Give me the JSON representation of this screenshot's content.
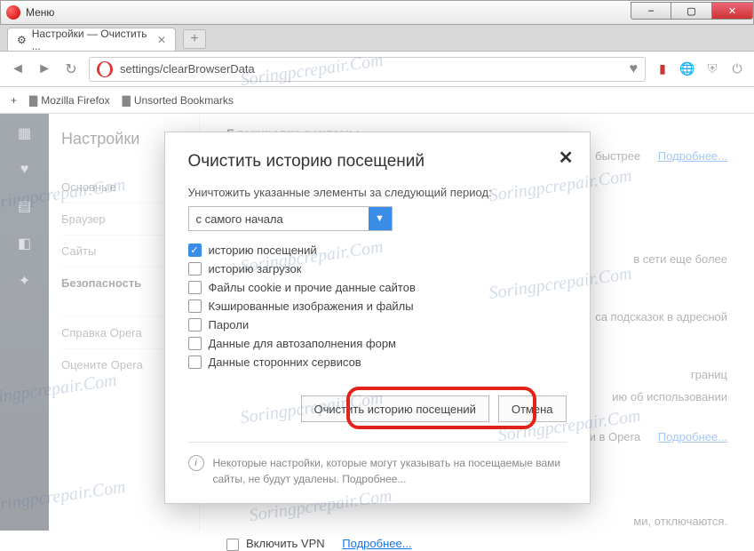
{
  "window": {
    "menu_label": "Меню",
    "min": "–",
    "max": "▢",
    "close": "✕"
  },
  "tab": {
    "title": "Настройки — Очистить ...",
    "close": "✕",
    "newtab": "+"
  },
  "addr": {
    "url": "settings/clearBrowserData"
  },
  "bookmarks": {
    "add": "+",
    "items": [
      "Mozilla Firefox",
      "Unsorted Bookmarks"
    ]
  },
  "rail_icons": [
    "grid-icon",
    "heart-icon",
    "news-icon",
    "sidebar-icon",
    "puzzle-icon"
  ],
  "settings_nav": {
    "title": "Настройки",
    "items": [
      "Основные",
      "Браузер",
      "Сайты",
      "Безопасность",
      "Справка Opera",
      "Оцените Opera"
    ],
    "active_index": 3
  },
  "bg": {
    "heading": "Блокировка рекламы",
    "more": "Подробнее...",
    "frag1": "быстрее",
    "frag2": "в сети еще более",
    "frag3": "са подсказок в адресной",
    "frag4": "границ",
    "frag5": "ию об использовании",
    "frag6_a": "и в Opera",
    "frag7": "ми, отключаются.",
    "vpn_label": "Включить VPN",
    "vpn_more": "Подробнее..."
  },
  "modal": {
    "title": "Очистить историю посещений",
    "subtitle": "Уничтожить указанные элементы за следующий период:",
    "period": "с самого начала",
    "checks": [
      {
        "label": "историю посещений",
        "on": true
      },
      {
        "label": "историю загрузок",
        "on": false
      },
      {
        "label": "Файлы cookie и прочие данные сайтов",
        "on": false
      },
      {
        "label": "Кэшированные изображения и файлы",
        "on": false
      },
      {
        "label": "Пароли",
        "on": false
      },
      {
        "label": "Данные для автозаполнения форм",
        "on": false
      },
      {
        "label": "Данные сторонних сервисов",
        "on": false
      }
    ],
    "clear_btn": "Очистить историю посещений",
    "cancel_btn": "Отмена",
    "note_a": "Некоторые настройки, которые могут указывать на посещаемые вами сайты, ",
    "note_b": "не будут удалены",
    "note_c": ". ",
    "note_link": "Подробнее..."
  },
  "watermark": "Soringpcrepair.Com"
}
